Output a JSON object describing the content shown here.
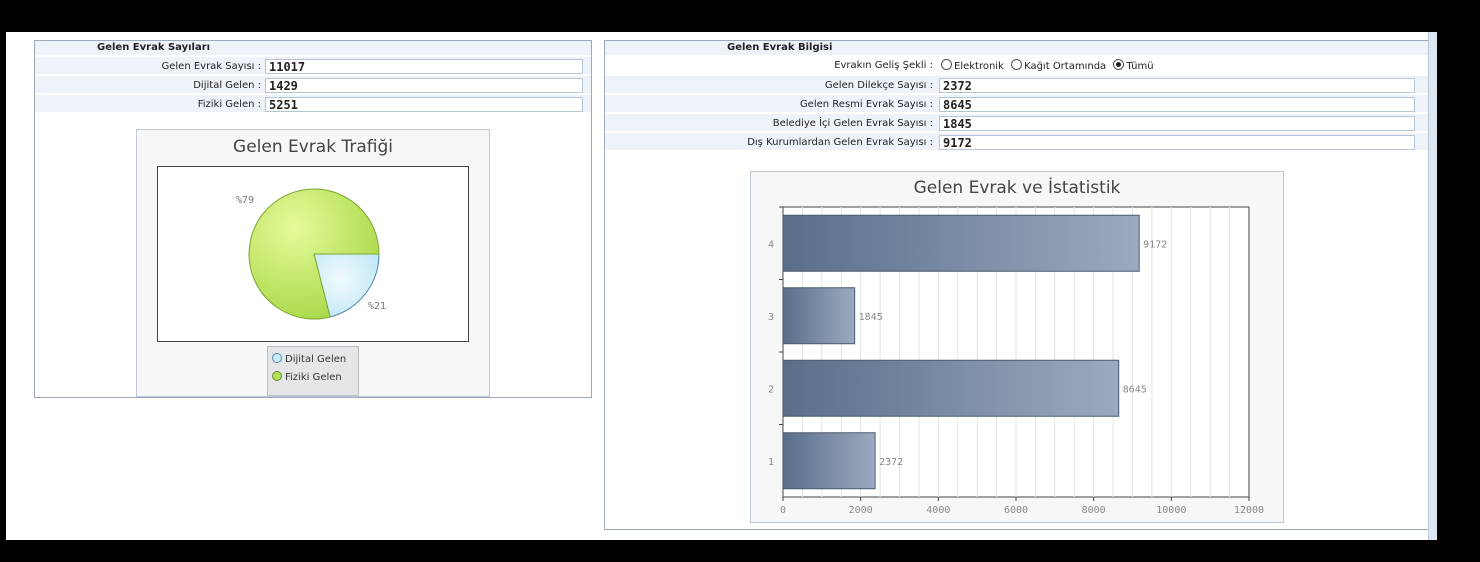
{
  "left_panel": {
    "title": "Gelen Evrak Sayıları",
    "fields": [
      {
        "label": "Gelen Evrak Sayısı :",
        "value": "11017"
      },
      {
        "label": "Dijital Gelen :",
        "value": "1429"
      },
      {
        "label": "Fiziki Gelen :",
        "value": "5251"
      }
    ]
  },
  "right_panel": {
    "title": "Gelen Evrak Bilgisi",
    "radio_label": "Evrakın Geliş Şekli :",
    "radio_options": [
      {
        "label": "Elektronik",
        "checked": false
      },
      {
        "label": "Kağıt Ortamında",
        "checked": false
      },
      {
        "label": "Tümü",
        "checked": true
      }
    ],
    "fields": [
      {
        "label": "Gelen Dilekçe Sayısı :",
        "value": "2372"
      },
      {
        "label": "Gelen Resmi Evrak Sayısı :",
        "value": "8645"
      },
      {
        "label": "Belediye İçi Gelen Evrak Sayısı :",
        "value": "1845"
      },
      {
        "label": "Dış Kurumlardan Gelen Evrak Sayısı :",
        "value": "9172"
      }
    ]
  },
  "chart_data": [
    {
      "type": "pie",
      "title": "Gelen Evrak Trafiği",
      "slices": [
        {
          "name": "Dijital Gelen",
          "value": 21,
          "label": "%21",
          "color": "#c8ecf8"
        },
        {
          "name": "Fiziki Gelen",
          "value": 79,
          "label": "%79",
          "color": "#b4e05a"
        }
      ],
      "legend": [
        "Dijital Gelen",
        "Fiziki Gelen"
      ],
      "legend_position": "bottom"
    },
    {
      "type": "bar",
      "orientation": "horizontal",
      "title": "Gelen Evrak ve İstatistik",
      "categories": [
        "1",
        "2",
        "3",
        "4"
      ],
      "values": [
        2372,
        8645,
        1845,
        9172
      ],
      "xlim": [
        0,
        12000
      ],
      "xticks": [
        0,
        2000,
        4000,
        6000,
        8000,
        10000,
        12000
      ],
      "grid": "vertical",
      "bar_color": "#6c7f99"
    }
  ]
}
